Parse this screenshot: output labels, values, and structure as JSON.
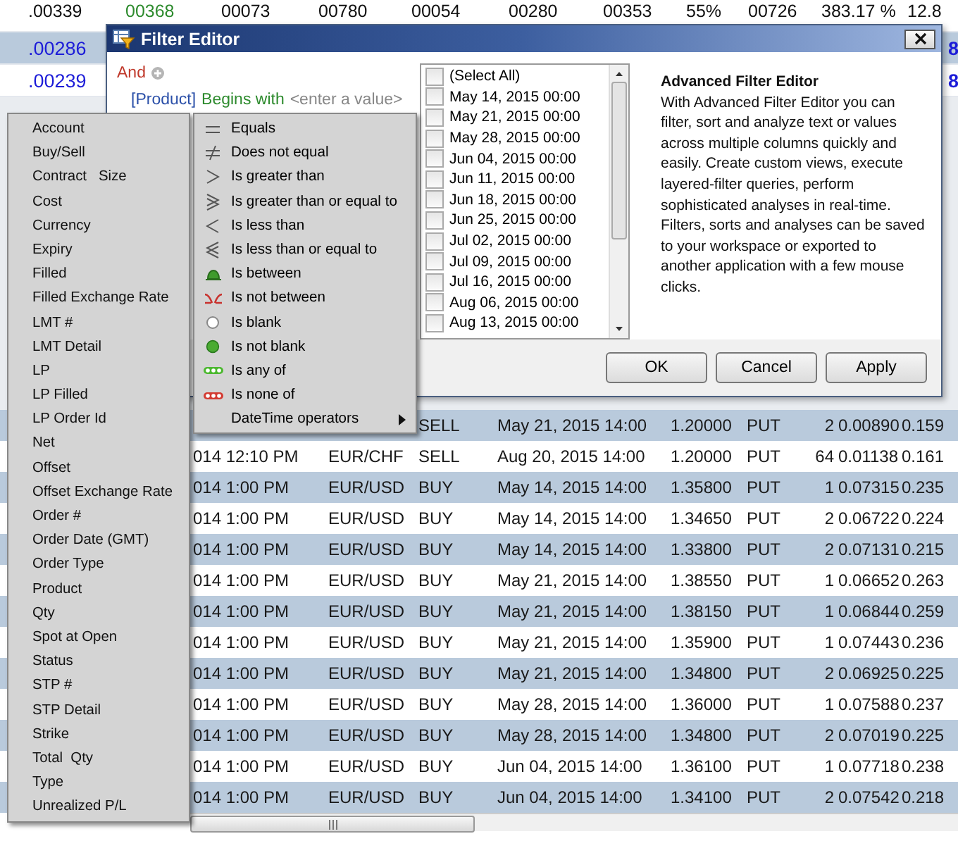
{
  "top_grid": {
    "rows": [
      {
        "cells": [
          {
            "text": ".00339"
          },
          {
            "text": "00368",
            "color": "#2e8b2e"
          },
          {
            "text": "00073"
          },
          {
            "text": "00780"
          },
          {
            "text": "00054"
          },
          {
            "text": "00280"
          },
          {
            "text": "00353"
          },
          {
            "text": "55%"
          },
          {
            "text": "00726"
          },
          {
            "text": "383.17 %"
          },
          {
            "text": "12.8"
          }
        ]
      },
      {
        "cells": [
          {
            "text": ".00286",
            "color": "#1c1cd8"
          }
        ],
        "edge": "8"
      },
      {
        "cells": [
          {
            "text": ".00239",
            "color": "#1c1cd8"
          }
        ],
        "edge": "8"
      }
    ]
  },
  "filter_editor": {
    "title": "Filter Editor",
    "group_operator": "And",
    "condition": {
      "field": "[Product]",
      "operator": "Begins with",
      "placeholder": "<enter a value>"
    },
    "value_list": [
      {
        "label": "(Select All)",
        "checked": false
      },
      {
        "label": "May 14, 2015 00:00",
        "checked": false
      },
      {
        "label": "May 21, 2015 00:00",
        "checked": false
      },
      {
        "label": "May 28, 2015 00:00",
        "checked": false
      },
      {
        "label": "Jun 04, 2015 00:00",
        "checked": false
      },
      {
        "label": "Jun 11, 2015 00:00",
        "checked": false
      },
      {
        "label": "Jun 18, 2015 00:00",
        "checked": false
      },
      {
        "label": "Jun 25, 2015 00:00",
        "checked": false
      },
      {
        "label": "Jul 02, 2015 00:00",
        "checked": false
      },
      {
        "label": "Jul 09, 2015 00:00",
        "checked": false
      },
      {
        "label": "Jul 16, 2015 00:00",
        "checked": false
      },
      {
        "label": "Aug 06, 2015 00:00",
        "checked": false
      },
      {
        "label": "Aug 13, 2015 00:00",
        "checked": false
      }
    ],
    "help": {
      "title": "Advanced Filter Editor",
      "body": "With Advanced Filter Editor you can filter, sort and analyze text or values across multiple columns quickly and easily. Create custom views, execute layered-filter queries, perform sophisticated analyses in real-time. Filters, sorts and analyses can be saved to your workspace or exported to another application with a few mouse clicks."
    },
    "buttons": [
      "OK",
      "Cancel",
      "Apply"
    ]
  },
  "column_menu": {
    "items": [
      "Account",
      "Buy/Sell",
      "Contract   Size",
      "Cost",
      "Currency",
      "Expiry",
      "Filled",
      "Filled Exchange Rate",
      "LMT #",
      "LMT Detail",
      "LP",
      "LP Filled",
      "LP Order Id",
      "Net",
      "Offset",
      "Offset Exchange Rate",
      "Order #",
      "Order Date (GMT)",
      "Order Type",
      "Product",
      "Qty",
      "Spot at Open",
      "Status",
      "STP #",
      "STP Detail",
      "Strike",
      "Total  Qty",
      "Type",
      "Unrealized P/L"
    ]
  },
  "operator_menu": {
    "items": [
      {
        "label": "Equals",
        "kind": "equals",
        "has_submenu": false
      },
      {
        "label": "Does not equal",
        "kind": "not_equal",
        "has_submenu": false
      },
      {
        "label": "Is greater than",
        "kind": "greater",
        "has_submenu": false
      },
      {
        "label": "Is greater than or equal to",
        "kind": "greater_equal",
        "has_submenu": false
      },
      {
        "label": "Is less than",
        "kind": "less",
        "has_submenu": false
      },
      {
        "label": "Is less than or equal to",
        "kind": "less_equal",
        "has_submenu": false
      },
      {
        "label": "Is between",
        "kind": "between",
        "has_submenu": false
      },
      {
        "label": "Is not between",
        "kind": "not_between",
        "has_submenu": false
      },
      {
        "label": "Is blank",
        "kind": "blank",
        "has_submenu": false
      },
      {
        "label": "Is not blank",
        "kind": "not_blank",
        "has_submenu": false
      },
      {
        "label": "Is any of",
        "kind": "any_of",
        "has_submenu": false
      },
      {
        "label": "Is none of",
        "kind": "none_of",
        "has_submenu": false
      },
      {
        "label": "DateTime operators",
        "kind": "datetime",
        "has_submenu": true
      }
    ]
  },
  "orders": {
    "rows": [
      {
        "side": "SELL",
        "expiry": "May 21, 2015 14:00",
        "strike": "1.20000",
        "type": "PUT",
        "qty": "2",
        "premium": "0.00890",
        "column_9": "0.159"
      },
      {
        "time": "014 12:10 PM",
        "pair": "EUR/CHF",
        "side": "SELL",
        "expiry": "Aug 20, 2015 14:00",
        "strike": "1.20000",
        "type": "PUT",
        "qty": "64",
        "premium": "0.01138",
        "column_9": "0.161"
      },
      {
        "time": "014 1:00 PM",
        "pair": "EUR/USD",
        "side": "BUY",
        "expiry": "May 14, 2015 14:00",
        "strike": "1.35800",
        "type": "PUT",
        "qty": "1",
        "premium": "0.07315",
        "column_9": "0.235"
      },
      {
        "time": "014 1:00 PM",
        "pair": "EUR/USD",
        "side": "BUY",
        "expiry": "May 14, 2015 14:00",
        "strike": "1.34650",
        "type": "PUT",
        "qty": "2",
        "premium": "0.06722",
        "column_9": "0.224"
      },
      {
        "time": "014 1:00 PM",
        "pair": "EUR/USD",
        "side": "BUY",
        "expiry": "May 14, 2015 14:00",
        "strike": "1.33800",
        "type": "PUT",
        "qty": "2",
        "premium": "0.07131",
        "column_9": "0.215"
      },
      {
        "time": "014 1:00 PM",
        "pair": "EUR/USD",
        "side": "BUY",
        "expiry": "May 21, 2015 14:00",
        "strike": "1.38550",
        "type": "PUT",
        "qty": "1",
        "premium": "0.06652",
        "column_9": "0.263"
      },
      {
        "time": "014 1:00 PM",
        "pair": "EUR/USD",
        "side": "BUY",
        "expiry": "May 21, 2015 14:00",
        "strike": "1.38150",
        "type": "PUT",
        "qty": "1",
        "premium": "0.06844",
        "column_9": "0.259"
      },
      {
        "time": "014 1:00 PM",
        "pair": "EUR/USD",
        "side": "BUY",
        "expiry": "May 21, 2015 14:00",
        "strike": "1.35900",
        "type": "PUT",
        "qty": "1",
        "premium": "0.07443",
        "column_9": "0.236"
      },
      {
        "time": "014 1:00 PM",
        "pair": "EUR/USD",
        "side": "BUY",
        "expiry": "May 21, 2015 14:00",
        "strike": "1.34800",
        "type": "PUT",
        "qty": "2",
        "premium": "0.06925",
        "column_9": "0.225"
      },
      {
        "time": "014 1:00 PM",
        "pair": "EUR/USD",
        "side": "BUY",
        "expiry": "May 28, 2015 14:00",
        "strike": "1.36000",
        "type": "PUT",
        "qty": "1",
        "premium": "0.07588",
        "column_9": "0.237"
      },
      {
        "time": "014 1:00 PM",
        "pair": "EUR/USD",
        "side": "BUY",
        "expiry": "May 28, 2015 14:00",
        "strike": "1.34800",
        "type": "PUT",
        "qty": "2",
        "premium": "0.07019",
        "column_9": "0.225"
      },
      {
        "time": "014 1:00 PM",
        "pair": "EUR/USD",
        "side": "BUY",
        "expiry": "Jun 04, 2015 14:00",
        "strike": "1.36100",
        "type": "PUT",
        "qty": "1",
        "premium": "0.07718",
        "column_9": "0.238"
      },
      {
        "time": "014 1:00 PM",
        "pair": "EUR/USD",
        "side": "BUY",
        "expiry": "Jun 04, 2015 14:00",
        "strike": "1.34100",
        "type": "PUT",
        "qty": "2",
        "premium": "0.07542",
        "column_9": "0.218"
      }
    ]
  }
}
